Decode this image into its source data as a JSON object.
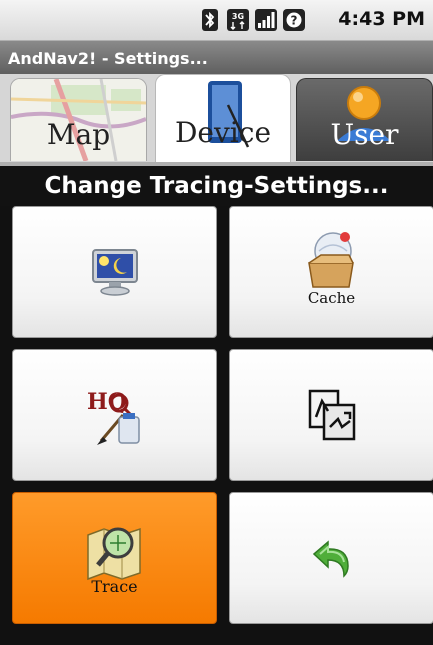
{
  "status_bar": {
    "time": "4:43 PM",
    "icons": [
      "bluetooth-icon",
      "3g-data-icon",
      "signal-icon",
      "alert-icon"
    ],
    "signal_text": "3G"
  },
  "app": {
    "title": "AndNav2! - Settings..."
  },
  "tabs": [
    {
      "label": "Map",
      "icon": "map-icon",
      "selected": false
    },
    {
      "label": "Device",
      "icon": "device-icon",
      "selected": true
    },
    {
      "label": "User",
      "icon": "user-icon",
      "selected": false
    }
  ],
  "heading": "Change Tracing-Settings...",
  "tiles": [
    {
      "name": "display",
      "icon": "monitor-moon-icon",
      "label": ""
    },
    {
      "name": "cache",
      "icon": "cache-box-icon",
      "label": "Cache"
    },
    {
      "name": "hq-quality",
      "icon": "hq-brush-icon",
      "label": ""
    },
    {
      "name": "format",
      "icon": "page-arrows-icon",
      "label": ""
    },
    {
      "name": "trace",
      "icon": "trace-map-icon",
      "label": "Trace",
      "active": true
    },
    {
      "name": "back",
      "icon": "back-arrow-icon",
      "label": ""
    }
  ],
  "colors": {
    "accent_active": "#f57a00",
    "heading_bg": "#121212",
    "title_bar": "#5e5e5e"
  }
}
